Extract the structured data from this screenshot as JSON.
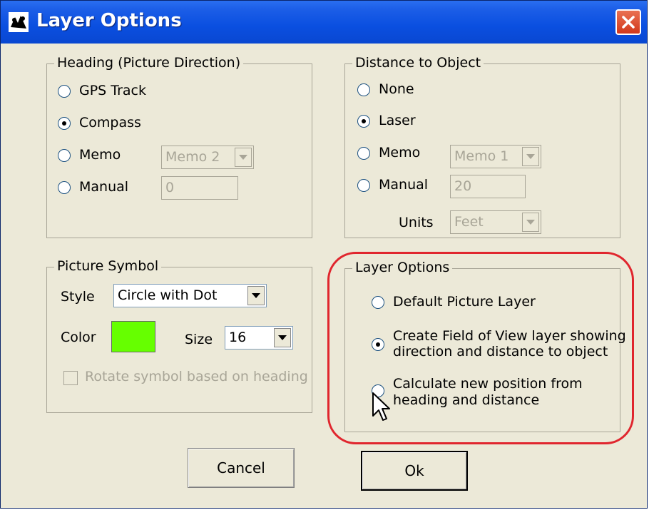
{
  "window": {
    "title": "Layer Options",
    "close_glyph": "✕",
    "accent_color": "#0a4fe0"
  },
  "heading": {
    "legend": "Heading (Picture Direction)",
    "options": [
      {
        "label": "GPS Track",
        "checked": false
      },
      {
        "label": "Compass",
        "checked": true
      },
      {
        "label": "Memo",
        "checked": false
      },
      {
        "label": "Manual",
        "checked": false
      }
    ],
    "memo_select": "Memo 2",
    "manual_value": "0"
  },
  "distance": {
    "legend": "Distance to Object",
    "options": [
      {
        "label": "None",
        "checked": false
      },
      {
        "label": "Laser",
        "checked": true
      },
      {
        "label": "Memo",
        "checked": false
      },
      {
        "label": "Manual",
        "checked": false
      }
    ],
    "memo_select": "Memo 1",
    "manual_value": "20",
    "units_label": "Units",
    "units_select": "Feet"
  },
  "symbol": {
    "legend": "Picture Symbol",
    "style_label": "Style",
    "style_value": "Circle with Dot",
    "color_label": "Color",
    "color_value": "#66ff00",
    "size_label": "Size",
    "size_value": "16",
    "rotate_label": "Rotate symbol based on heading",
    "rotate_checked": false
  },
  "layer_options": {
    "legend": "Layer Options",
    "options": [
      {
        "label": "Default Picture Layer",
        "checked": false
      },
      {
        "line1": "Create Field of View layer showing",
        "line2": "direction and distance to object",
        "checked": true
      },
      {
        "line1": "Calculate new position from",
        "line2": "heading and distance",
        "checked": false
      }
    ],
    "highlight_color": "#e0262e"
  },
  "buttons": {
    "cancel": "Cancel",
    "ok": "Ok"
  }
}
